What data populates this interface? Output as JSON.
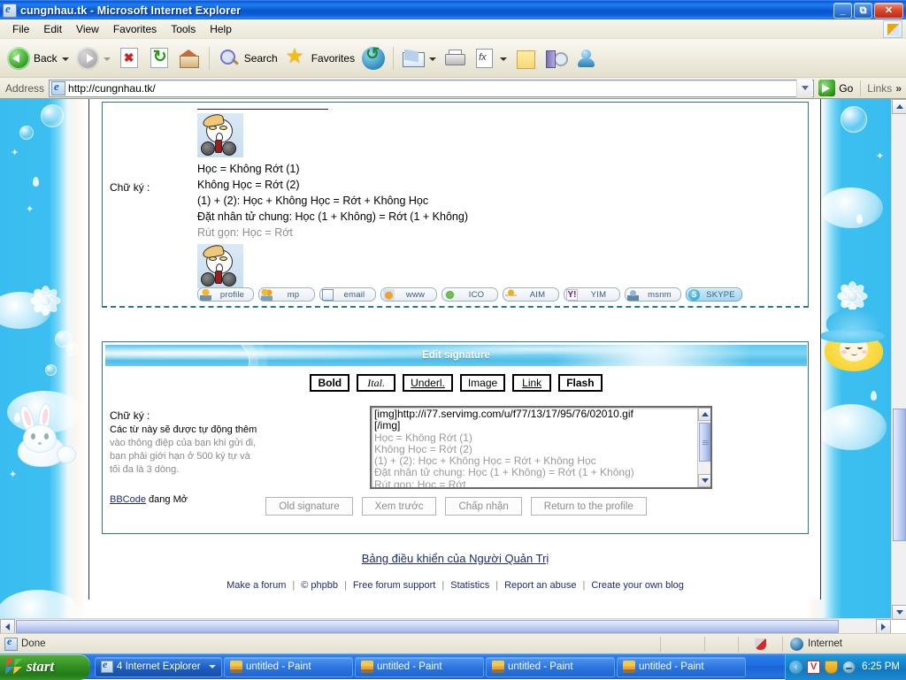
{
  "window": {
    "title": "cungnhau.tk - Microsoft Internet Explorer",
    "icon": "ie-document-icon",
    "minimize_label": "_",
    "maximize_label": "❐",
    "close_label": "✕"
  },
  "menubar": {
    "items": [
      "File",
      "Edit",
      "View",
      "Favorites",
      "Tools",
      "Help"
    ]
  },
  "toolbar": {
    "back_label": "Back",
    "search_label": "Search",
    "favorites_label": "Favorites",
    "icons": [
      "back-icon",
      "forward-icon",
      "stop-icon",
      "refresh-icon",
      "home-icon",
      "search-icon",
      "favorites-star-icon",
      "history-icon",
      "mail-icon",
      "print-icon",
      "edit-icon",
      "notes-icon",
      "research-icon",
      "messenger-icon"
    ]
  },
  "address": {
    "label": "Address",
    "url": "http://cungnhau.tk/",
    "go_label": "Go",
    "links_label": "Links",
    "chevron": "»"
  },
  "signature_view": {
    "label": "Chữ ký :",
    "lines": [
      {
        "text": "Học = Không Rớt (1)",
        "dim": false
      },
      {
        "text": "Không Học = Rớt (2)",
        "dim": false
      },
      {
        "text": "(1) + (2): Học + Không Học = Rớt + Không Học",
        "dim": false
      },
      {
        "text": "Đặt nhân tử chung: Học (1 + Không) = Rớt (1 + Không)",
        "dim": false
      },
      {
        "text": "Rút gọn: Học = Rớt",
        "dim": true
      }
    ],
    "avatar_alt": "cartoon-character-image"
  },
  "contact_buttons": [
    {
      "label": "profile",
      "icon": "user-icon"
    },
    {
      "label": "mp",
      "icon": "private-message-icon"
    },
    {
      "label": "email",
      "icon": "envelope-icon"
    },
    {
      "label": "www",
      "icon": "website-icon"
    },
    {
      "label": "ICO",
      "icon": "icq-flower-icon"
    },
    {
      "label": "AIM",
      "icon": "aim-runner-icon"
    },
    {
      "label": "YIM",
      "icon": "yahoo-messenger-icon"
    },
    {
      "label": "msnm",
      "icon": "msn-messenger-icon"
    },
    {
      "label": "SKYPE",
      "icon": "skype-icon"
    }
  ],
  "edit_panel": {
    "title": "Edit signature",
    "format_buttons": [
      {
        "label": "Bold",
        "style": "b"
      },
      {
        "label": "Ital.",
        "style": "i"
      },
      {
        "label": "Underl.",
        "style": "u"
      },
      {
        "label": "Image",
        "style": "n"
      },
      {
        "label": "Link",
        "style": "lk"
      },
      {
        "label": "Flash",
        "style": "fl"
      }
    ],
    "left": {
      "title": "Chữ ký :",
      "help_line1": "Các từ này sẽ được tự động thêm",
      "help_line2": "vào thông điệp của bạn khi gửi đi,",
      "help_line3": "bạn phải giới hạn ở 500 ký tự và",
      "help_line4": "tối đa là 3 dòng.",
      "bbcode_link": "BBCode",
      "bbcode_status": "đang Mở"
    },
    "textarea": {
      "line1": "[img]http://i77.servimg.com/u/f77/13/17/95/76/02010.gif",
      "line2": "[/img]",
      "line3": "Học = Không Rớt (1)",
      "line4": "Không Học = Rớt (2)",
      "line5": "(1) + (2): Học + Không Học = Rớt + Không Học",
      "line6": "Đặt nhân tử chung: Học (1 + Không) = Rớt (1 + Không)",
      "line7": "Rút gọn: Học = Rớt"
    },
    "actions": [
      {
        "label": "Old signature"
      },
      {
        "label": "Xem trước"
      },
      {
        "label": "Chấp nhận"
      },
      {
        "label": "Return to the profile"
      }
    ]
  },
  "footer": {
    "admin_link": "Bảng điều khiển của Người Quản Trị",
    "links": [
      "Make a forum",
      "© phpbb",
      "Free forum support",
      "Statistics",
      "Report an abuse",
      "Create your own blog"
    ],
    "separator": "|"
  },
  "statusbar": {
    "text": "Done",
    "zone": "Internet",
    "icons": [
      "ie-icon",
      "security-shield-icon",
      "internet-globe-icon"
    ]
  },
  "taskbar": {
    "start_label": "start",
    "items": [
      {
        "label": "4 Internet Explorer",
        "icon": "ie-icon",
        "grouped": true
      },
      {
        "label": "untitled - Paint",
        "icon": "paint-icon",
        "grouped": false
      },
      {
        "label": "untitled - Paint",
        "icon": "paint-icon",
        "grouped": false
      },
      {
        "label": "untitled - Paint",
        "icon": "paint-icon",
        "grouped": false
      },
      {
        "label": "untitled - Paint",
        "icon": "paint-icon",
        "grouped": false
      }
    ],
    "tray": {
      "chevron": "‹",
      "icons": [
        "antivirus-v-icon",
        "security-shield-icon",
        "msn-messenger-icon"
      ],
      "clock": "6:25 PM"
    }
  },
  "theme": {
    "title_blue": "#0a53cc",
    "accent_blue": "#39bdf0",
    "link_color": "#1b2b7a",
    "panel_border": "#2a7a8c"
  }
}
